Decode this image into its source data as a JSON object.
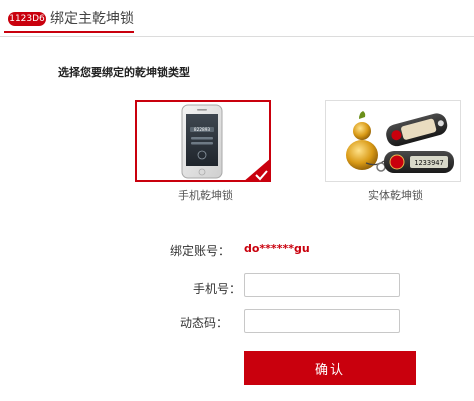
{
  "header": {
    "badge": "1123D6",
    "title": "绑定主乾坤锁"
  },
  "prompt": "选择您要绑定的乾坤锁类型",
  "options": [
    {
      "label": "手机乾坤锁",
      "selected": true,
      "screen_code": "822893"
    },
    {
      "label": "实体乾坤锁",
      "selected": false,
      "token_code": "1233947"
    }
  ],
  "form": {
    "account_label": "绑定账号：",
    "account_value": "do******gu",
    "phone_label": "手机号：",
    "phone_value": "",
    "code_label": "动态码：",
    "code_value": "",
    "confirm_label": "确认"
  },
  "colors": {
    "accent": "#c9000d",
    "border": "#dcdcdc"
  }
}
